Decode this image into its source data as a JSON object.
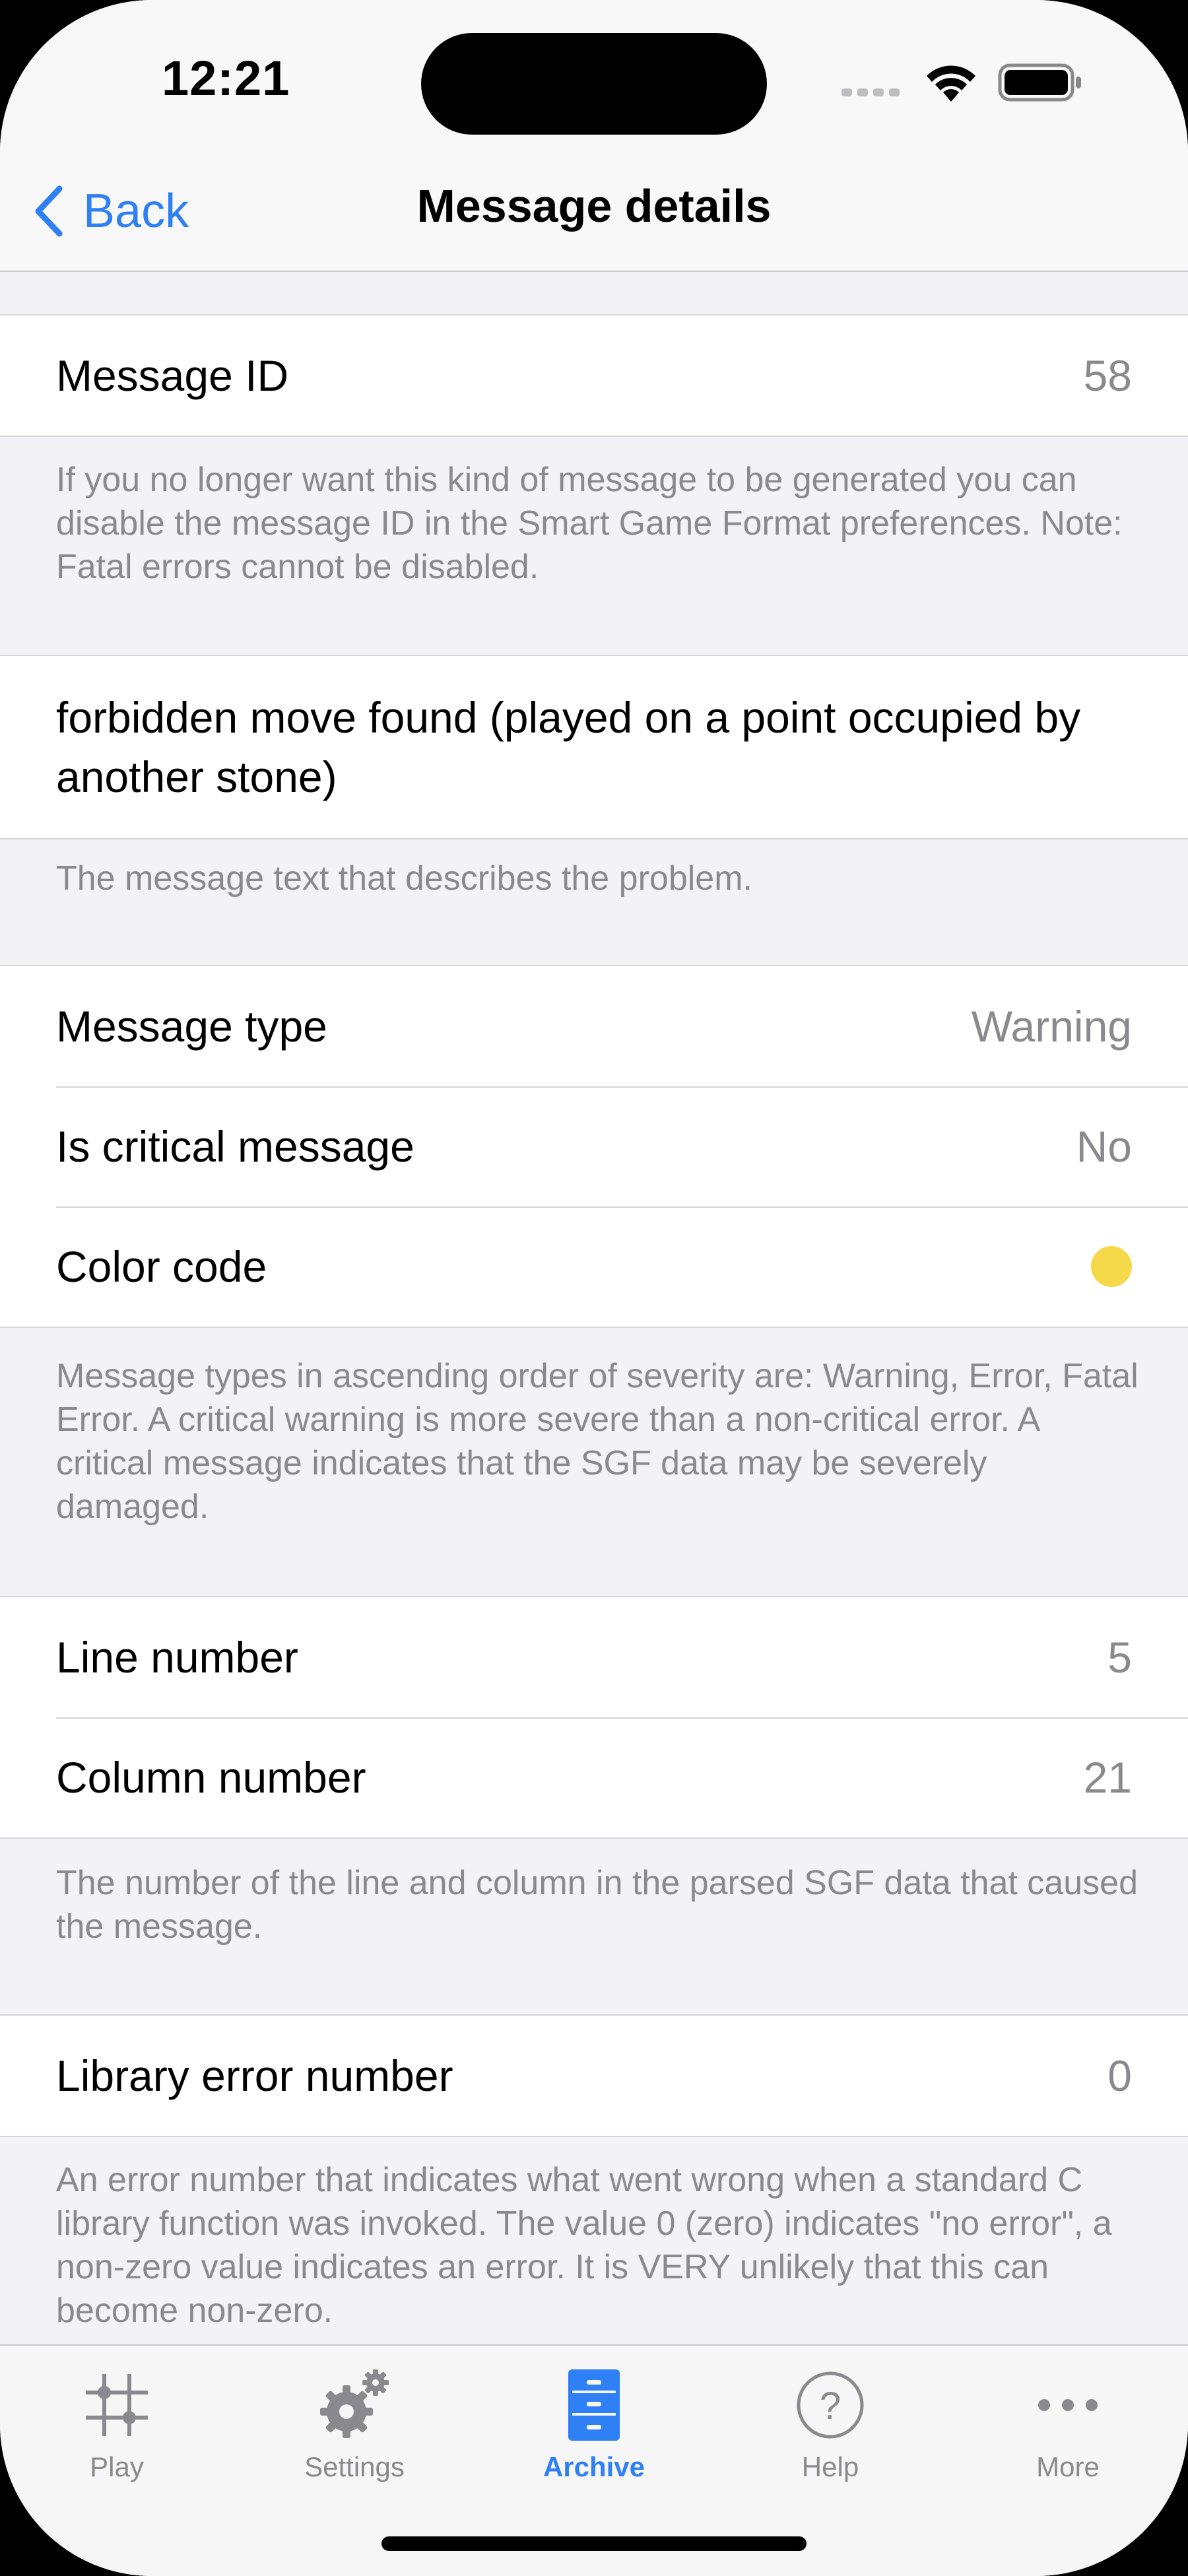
{
  "status": {
    "time": "12:21"
  },
  "nav": {
    "back_label": "Back",
    "title": "Message details"
  },
  "sections": {
    "message_id": {
      "label": "Message ID",
      "value": "58",
      "footer": "If you no longer want this kind of message to be generated you can disable the message ID in the Smart Game Format preferences. Note: Fatal errors cannot be disabled."
    },
    "message_text": {
      "text": "forbidden move found (played on a point occupied by another stone)",
      "footer": "The message text that describes the problem."
    },
    "type": {
      "rows": [
        {
          "label": "Message type",
          "value": "Warning"
        },
        {
          "label": "Is critical message",
          "value": "No"
        },
        {
          "label": "Color code",
          "color": "#f5d94a"
        }
      ],
      "footer": "Message types in ascending order of severity are: Warning, Error, Fatal Error. A critical warning is more severe than a non-critical error. A critical message indicates that the SGF data may be severely damaged."
    },
    "position": {
      "rows": [
        {
          "label": "Line number",
          "value": "5"
        },
        {
          "label": "Column number",
          "value": "21"
        }
      ],
      "footer": "The number of the line and column in the parsed SGF data that caused the message."
    },
    "library": {
      "label": "Library error number",
      "value": "0",
      "footer": "An error number that indicates what went wrong when a standard C library function was invoked. The value 0 (zero) indicates \"no error\", a non-zero value indicates an error. It is VERY unlikely that this can become non-zero."
    }
  },
  "tabs": [
    {
      "label": "Play",
      "icon": "play-grid-icon",
      "active": false
    },
    {
      "label": "Settings",
      "icon": "gears-icon",
      "active": false
    },
    {
      "label": "Archive",
      "icon": "archive-cabinet-icon",
      "active": true
    },
    {
      "label": "Help",
      "icon": "help-icon",
      "active": false
    },
    {
      "label": "More",
      "icon": "more-icon",
      "active": false
    }
  ],
  "colors": {
    "accent": "#2f7ff5",
    "background": "#f2f2f7",
    "secondary_text": "#8a8a8e"
  }
}
